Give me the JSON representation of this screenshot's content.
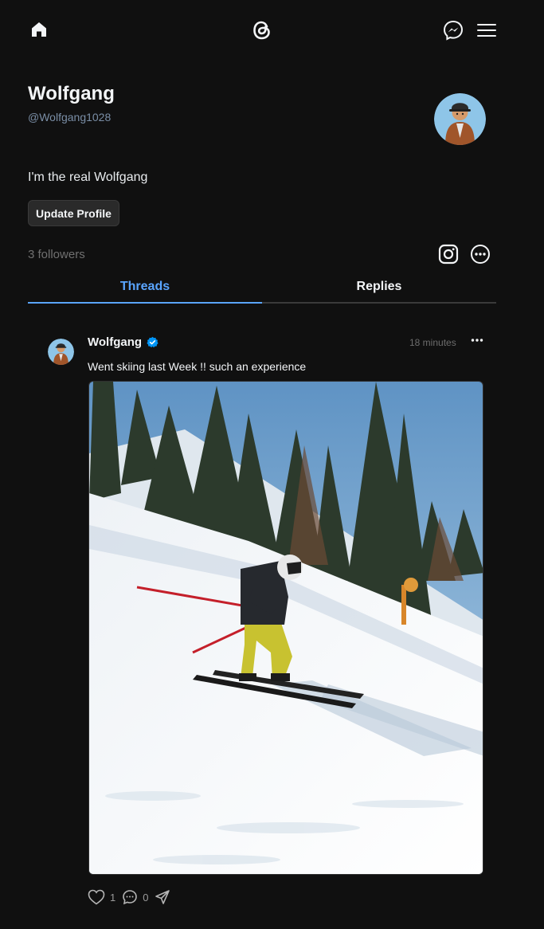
{
  "profile": {
    "name": "Wolfgang",
    "handle": "@Wolfgang1028",
    "bio": "I'm the real Wolfgang",
    "update_button": "Update Profile",
    "followers": "3 followers"
  },
  "tabs": [
    {
      "label": "Threads",
      "active": true
    },
    {
      "label": "Replies",
      "active": false
    }
  ],
  "post": {
    "author": "Wolfgang",
    "verified": true,
    "time": "18 minutes",
    "text": "Went skiing last Week !! such an experience",
    "likes": "1",
    "replies": "0"
  },
  "icons": [
    "home-icon",
    "threads-logo-icon",
    "messenger-icon",
    "menu-icon",
    "instagram-icon",
    "more-options-icon",
    "verified-badge-icon",
    "heart-icon",
    "comment-icon",
    "share-icon"
  ],
  "colors": {
    "background": "#101010",
    "accent": "#5aa5ff",
    "verified": "#0095f6",
    "avatar_bg": "#8ec5e8"
  }
}
